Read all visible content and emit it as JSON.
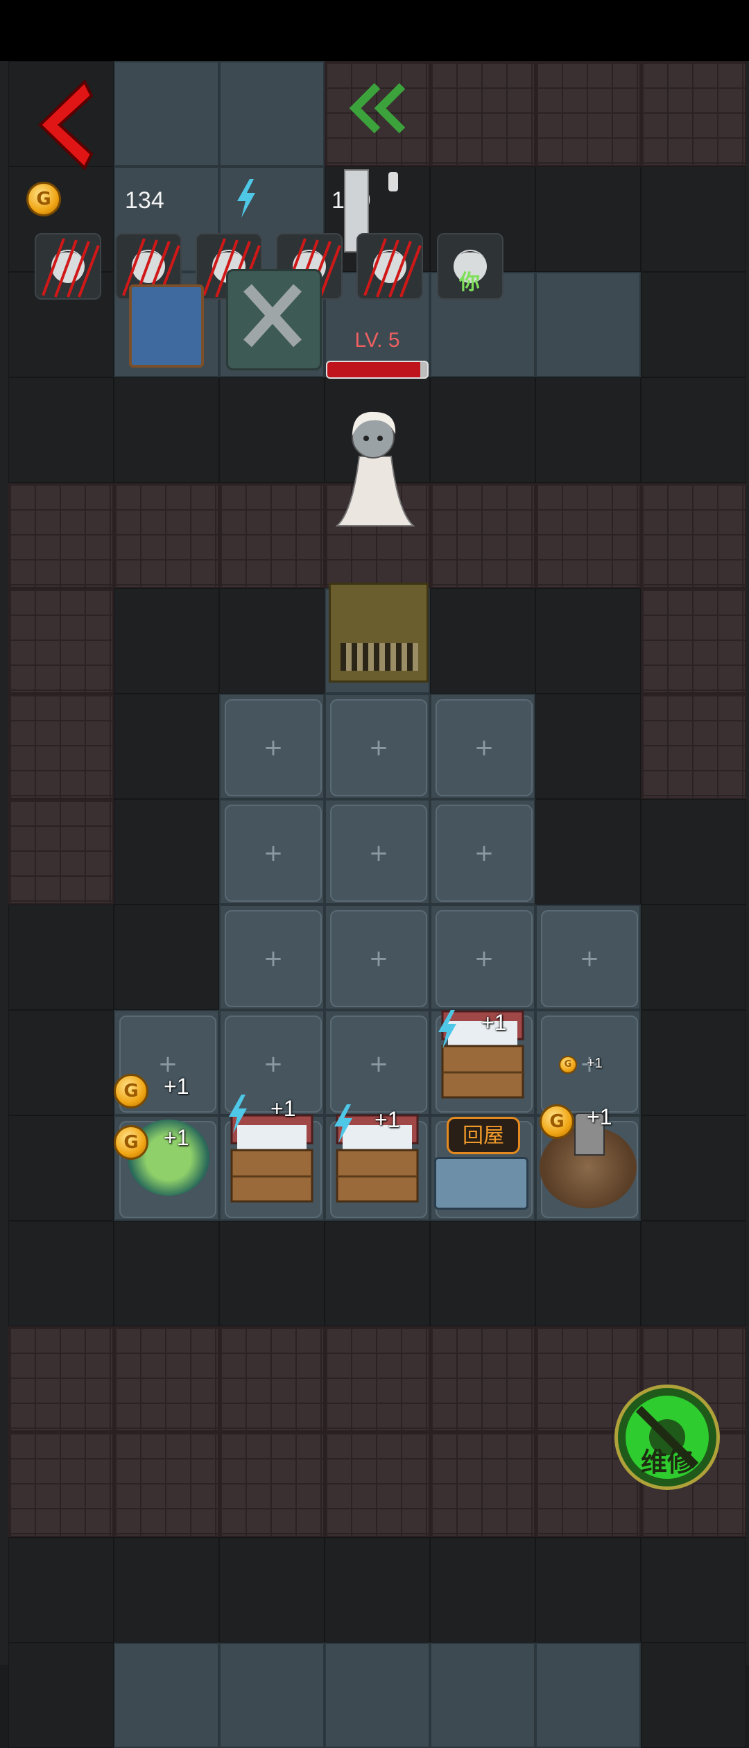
{
  "hud": {
    "gold_value": "134",
    "energy_value": "109",
    "coin_letter": "G"
  },
  "avatars": [
    {
      "name": "slashed-character-1",
      "slashed": true
    },
    {
      "name": "slashed-character-2",
      "slashed": true
    },
    {
      "name": "slashed-character-3",
      "slashed": true
    },
    {
      "name": "slashed-character-4",
      "slashed": true
    },
    {
      "name": "slashed-character-5",
      "slashed": true
    },
    {
      "name": "you-character",
      "label": "你",
      "slashed": false
    }
  ],
  "enemy": {
    "level_label": "LV. 5",
    "health_fraction": 0.93
  },
  "buildings": {
    "income_plus": "+1",
    "return_home_label": "回屋"
  },
  "repair_button": {
    "label": "维修",
    "icon": "wrench-gear-icon"
  },
  "colors": {
    "back_arrow": "#e01515",
    "double_chevron": "#3ca33c",
    "enemy_bar": "#c0141c",
    "return_button": "#e58a1f",
    "repair_button": "#2ecc2e"
  }
}
